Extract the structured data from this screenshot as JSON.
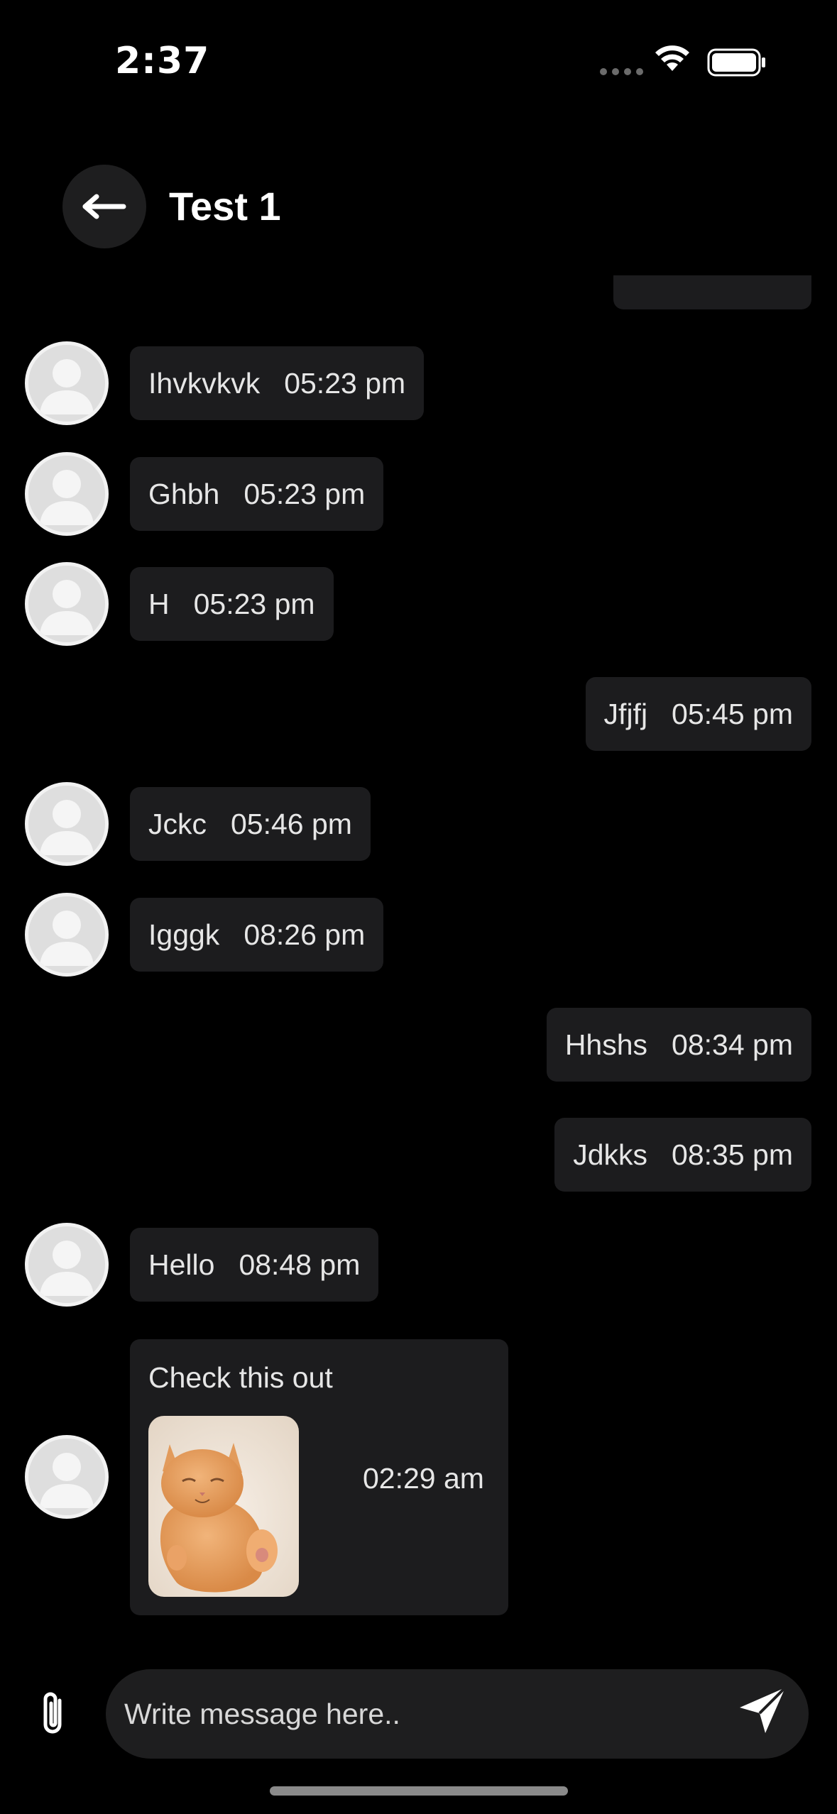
{
  "status_bar": {
    "time": "2:37"
  },
  "header": {
    "title": "Test 1",
    "back_icon": "arrow-left-icon"
  },
  "messages": [
    {
      "direction": "incoming",
      "text": "Ihvkvkvk",
      "time": "05:23 pm"
    },
    {
      "direction": "incoming",
      "text": "Ghbh",
      "time": "05:23 pm"
    },
    {
      "direction": "incoming",
      "text": "H",
      "time": "05:23 pm"
    },
    {
      "direction": "outgoing",
      "text": "Jfjfj",
      "time": "05:45 pm"
    },
    {
      "direction": "incoming",
      "text": "Jckc",
      "time": "05:46 pm"
    },
    {
      "direction": "incoming",
      "text": "Igggk",
      "time": "08:26 pm"
    },
    {
      "direction": "outgoing",
      "text": "Hhshs",
      "time": "08:34 pm"
    },
    {
      "direction": "outgoing",
      "text": "Jdkks",
      "time": "08:35 pm"
    },
    {
      "direction": "incoming",
      "text": "Hello",
      "time": "08:48 pm"
    }
  ],
  "image_message": {
    "direction": "incoming",
    "caption": "Check this out",
    "time": "02:29 am",
    "image": "kitten-photo"
  },
  "composer": {
    "placeholder": "Write message here..",
    "attach_icon": "paperclip-icon",
    "send_icon": "send-icon"
  },
  "colors": {
    "background": "#000000",
    "bubble": "#1c1c1e",
    "text": "#e6e6e6"
  }
}
